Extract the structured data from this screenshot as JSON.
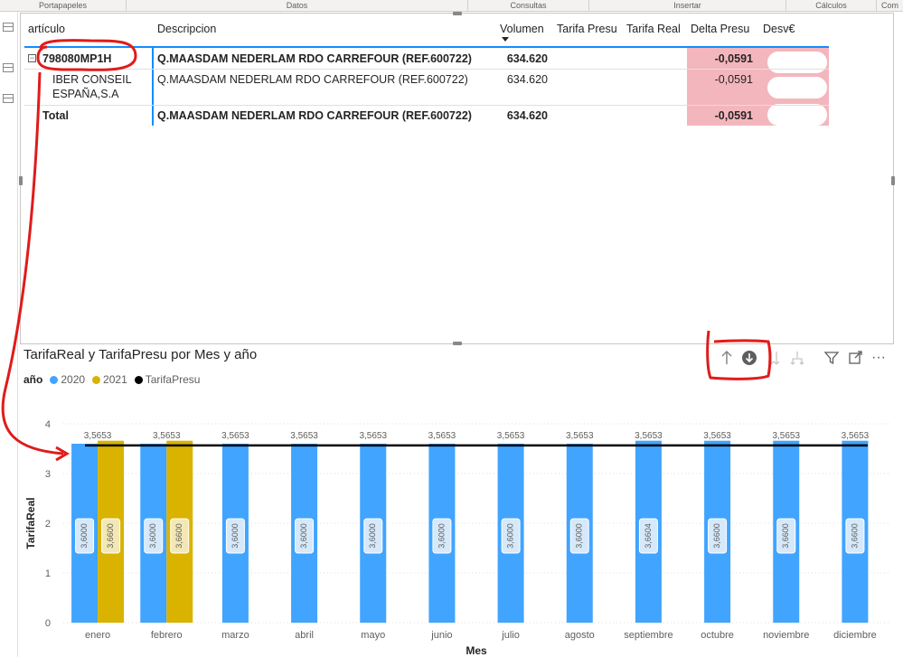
{
  "ribbon": {
    "groups": [
      "Portapapeles",
      "Datos",
      "Consultas",
      "Insertar",
      "Cálculos",
      "Com"
    ]
  },
  "matrix": {
    "headers": {
      "articulo": "artículo",
      "descripcion": "Descripcion",
      "volumen": "Volumen",
      "tarifa_presu": "Tarifa Presu",
      "tarifa_real": "Tarifa Real",
      "delta_presu": "Delta Presu",
      "desv": "Desv€"
    },
    "row_parent": {
      "articulo": "798080MP1H",
      "descripcion": "Q.MAASDAM NEDERLAM RDO CARREFOUR (REF.600722)",
      "volumen": "634.620",
      "delta_presu": "-0,0591"
    },
    "row_child": {
      "articulo_line1": "IBER CONSEIL",
      "articulo_line2": "ESPAÑA,S.A",
      "descripcion": "Q.MAASDAM NEDERLAM RDO CARREFOUR (REF.600722)",
      "volumen": "634.620",
      "delta_presu": "-0,0591"
    },
    "row_total": {
      "articulo": "Total",
      "descripcion": "Q.MAASDAM NEDERLAM RDO CARREFOUR (REF.600722)",
      "volumen": "634.620",
      "delta_presu": "-0,0591"
    }
  },
  "chart_header": {
    "title": "TarifaReal y TarifaPresu por Mes y año",
    "legend_label": "año",
    "legend_items": [
      "2020",
      "2021",
      "TarifaPresu"
    ]
  },
  "colors": {
    "series_2020": "#41a4ff",
    "series_2021": "#d9b300",
    "series_tarifapresu": "#000000",
    "delta_negative": "#f4b6bd",
    "annotation": "#e01b1b"
  },
  "icons": {
    "drill_up": "arrow-up-icon",
    "drill_down": "drill-down-circle-icon",
    "expand_next": "double-arrow-down-icon",
    "expand_hierarchy": "fork-icon",
    "filter": "filter-icon",
    "focus": "focus-mode-icon",
    "more": "more-options-icon"
  },
  "chart_data": {
    "type": "bar",
    "title": "TarifaReal y TarifaPresu por Mes y año",
    "xlabel": "Mes",
    "ylabel": "TarifaReal",
    "ylim": [
      0,
      4
    ],
    "yticks": [
      0,
      1,
      2,
      3,
      4
    ],
    "categories": [
      "enero",
      "febrero",
      "marzo",
      "abril",
      "mayo",
      "junio",
      "julio",
      "agosto",
      "septiembre",
      "octubre",
      "noviembre",
      "diciembre"
    ],
    "series": [
      {
        "name": "2020",
        "values": [
          3.6,
          3.6,
          3.6,
          3.6,
          3.6,
          3.6,
          3.6,
          3.6,
          3.6604,
          3.66,
          3.66,
          3.66
        ],
        "labels": [
          "3,6000",
          "3,6000",
          "3,6000",
          "3,6000",
          "3,6000",
          "3,6000",
          "3,6000",
          "3,6000",
          "3,6604",
          "3,6600",
          "3,6600",
          "3,6600"
        ]
      },
      {
        "name": "2021",
        "values": [
          3.66,
          3.66,
          null,
          null,
          null,
          null,
          null,
          null,
          null,
          null,
          null,
          null
        ],
        "labels": [
          "3,6600",
          "3,6600",
          "",
          "",
          "",
          "",
          "",
          "",
          "",
          "",
          "",
          ""
        ]
      }
    ],
    "line": {
      "name": "TarifaPresu",
      "values": [
        3.5653,
        3.5653,
        3.5653,
        3.5653,
        3.5653,
        3.5653,
        3.5653,
        3.5653,
        3.5653,
        3.5653,
        3.5653,
        3.5653
      ],
      "labels": [
        "3,5653",
        "3,5653",
        "3,5653",
        "3,5653",
        "3,5653",
        "3,5653",
        "3,5653",
        "3,5653",
        "3,5653",
        "3,5653",
        "3,5653",
        "3,5653"
      ]
    },
    "grid": true,
    "legend": "top-left"
  }
}
